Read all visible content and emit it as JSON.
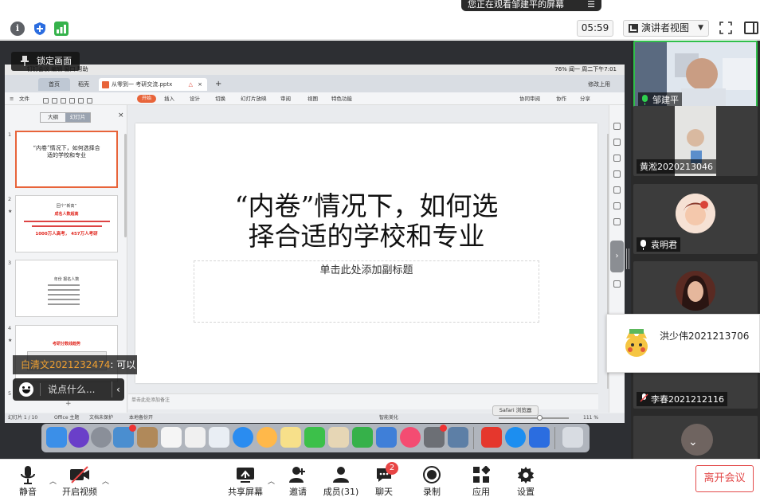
{
  "topbar": {
    "watch_banner": "您正在观看邹建平的屏幕",
    "watch_menu_icon": "list-menu-icon",
    "timer": "05:59",
    "view_label": "演讲者视图",
    "icons": [
      "info-icon",
      "shield-icon",
      "signal-icon",
      "fullscreen-icon",
      "sidebar-toggle-icon"
    ]
  },
  "share": {
    "lock_tip": "锁定画面",
    "mac_menubar": {
      "left": "钉钉会议   编辑   窗口   帮助",
      "right": "76%   闻一   周二下午7:01"
    },
    "wps_tabs": {
      "home": "首页",
      "template": "稻壳",
      "doc": "从零到一 考研交流.pptx",
      "plus": "+",
      "account": "修改上用"
    },
    "ribbon": {
      "file": "文件",
      "start": "开始",
      "items": [
        "插入",
        "设计",
        "切换",
        "幻灯片放映",
        "审阅",
        "视图",
        "特色功能"
      ],
      "right": [
        "协同审阅",
        "协作",
        "分享"
      ]
    },
    "thumb_panel": {
      "tab_outline": "大纲",
      "tab_slides": "幻灯片",
      "close": "×",
      "add": "+",
      "slides": [
        {
          "num": "1",
          "title": "“内卷”情况下，如何选择合适的学校和专业"
        },
        {
          "num": "2",
          "title": "回个“新高”",
          "sub": "成名人数超高",
          "foot": "1000万人高考， 457万人考研"
        },
        {
          "num": "3",
          "title": "年份  报名人数"
        },
        {
          "num": "4",
          "title": "考研分数线趋势"
        },
        {
          "num": "5"
        }
      ]
    },
    "slide": {
      "title_line1": "“内卷”情况下，如何选",
      "title_line2": "择合适的学校和专业",
      "subtitle": "单击此处添加副标题"
    },
    "notes_placeholder": "单击此处添加备注",
    "status": {
      "slide_count": "幻灯片 1 / 10",
      "theme": "Office 主题",
      "protect": "文档未保护",
      "backup": "本地备份开",
      "beautify": "智能美化",
      "zoom": "111 %",
      "safari": "Safari 浏览器"
    },
    "chat": {
      "sender": "白清文2021232474",
      "message": ": 可以",
      "placeholder": "说点什么...",
      "arrow": "‹"
    }
  },
  "participants": [
    {
      "name": "邹建平",
      "mic": "active"
    },
    {
      "name": "黄淞2020213046",
      "mic": "none"
    },
    {
      "name": "袁明君",
      "mic": "on"
    },
    {
      "name": "",
      "mic": "none"
    },
    {
      "name": "李春2021212116",
      "mic": "muted"
    }
  ],
  "popup": {
    "name": "洪少伟2021213706"
  },
  "toolbar": {
    "mute": "静音",
    "video": "开启视频",
    "share": "共享屏幕",
    "invite": "邀请",
    "members": "成员(31)",
    "chat": "聊天",
    "chat_badge": "2",
    "record": "录制",
    "apps": "应用",
    "settings": "设置",
    "leave": "离开会议"
  },
  "colors": {
    "accent_orange": "#e8643a",
    "active_speaker": "#2fbf4a",
    "leave_red": "#e34b4b"
  }
}
